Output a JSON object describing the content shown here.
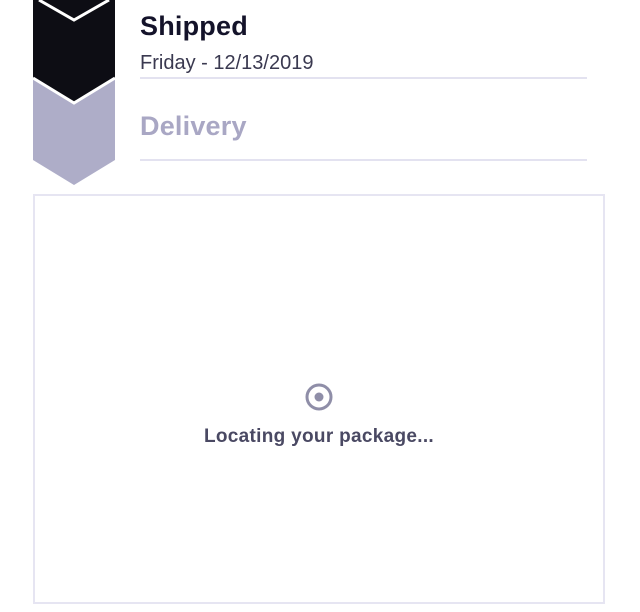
{
  "timeline": {
    "steps": [
      {
        "title": "Shipped",
        "date": "Friday - 12/13/2019",
        "status": "complete",
        "color": "#0d0d14"
      },
      {
        "title": "Delivery",
        "status": "pending",
        "color": "#aeadc8"
      }
    ]
  },
  "tracking": {
    "icon": "location-target-icon",
    "status_text": "Locating your package..."
  },
  "colors": {
    "complete": "#0d0d14",
    "pending": "#aeadc8",
    "divider": "#e3e2f0",
    "text_dark": "#14132a",
    "text_muted": "#a9a7c4"
  }
}
